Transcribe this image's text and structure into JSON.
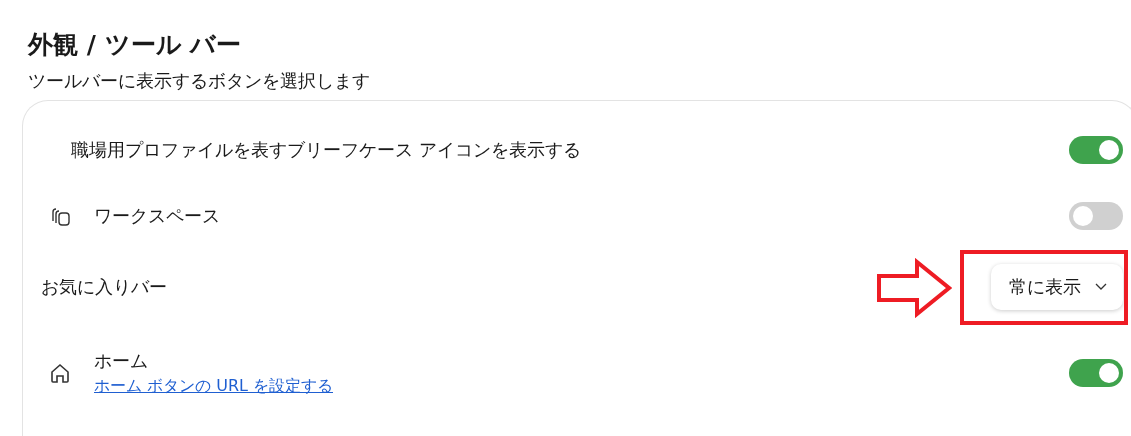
{
  "header": {
    "title": "外観 / ツール バー",
    "subtitle": "ツールバーに表示するボタンを選択します"
  },
  "settings": [
    {
      "kind": "toggle",
      "label": "職場用プロファイルを表すブリーフケース アイコンを表示する",
      "on": true
    },
    {
      "kind": "toggle",
      "label": "ワークスペース",
      "on": false
    },
    {
      "kind": "dropdown",
      "label": "お気に入りバー",
      "value": "常に表示",
      "highlighted": true
    },
    {
      "kind": "toggle",
      "label": "ホーム",
      "link": "ホーム ボタンの URL を設定する",
      "on": true
    }
  ]
}
